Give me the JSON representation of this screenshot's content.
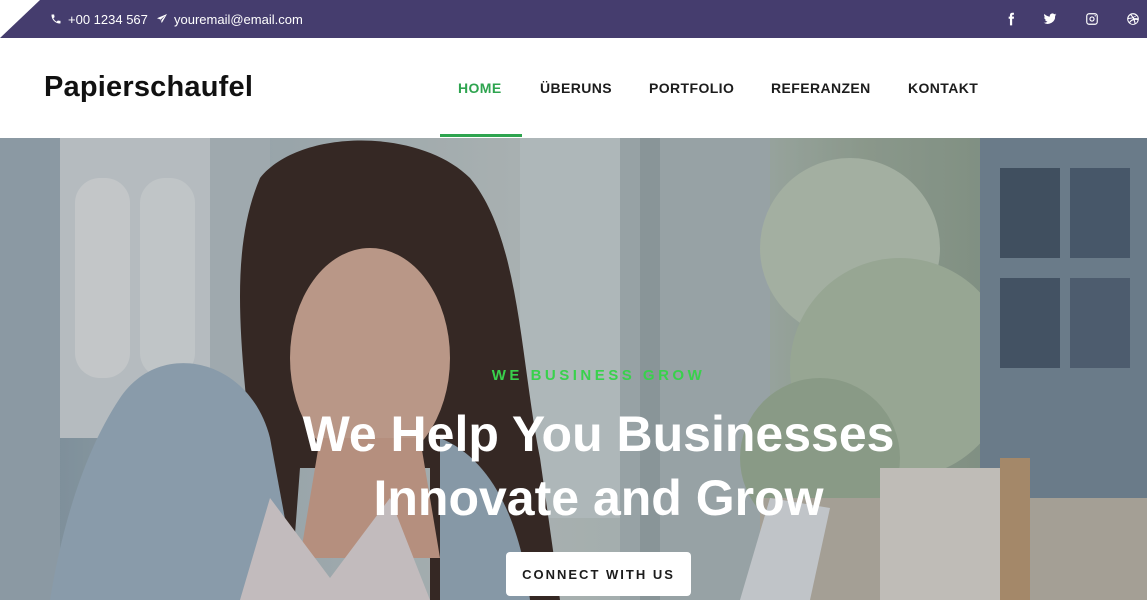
{
  "topbar": {
    "phone": "+00 1234 567",
    "email": "youremail@email.com",
    "icons": [
      "phone-icon",
      "paper-plane-icon"
    ],
    "social": [
      "facebook-icon",
      "twitter-icon",
      "instagram-icon",
      "dribbble-icon"
    ]
  },
  "colors": {
    "topbar": "#453d6e",
    "accent": "#2ea44f",
    "tagline": "#39d14c"
  },
  "brand": {
    "name": "Papierschaufel"
  },
  "nav": {
    "items": [
      {
        "label": "HOME",
        "active": true
      },
      {
        "label": "ÜBERUNS"
      },
      {
        "label": "PORTFOLIO"
      },
      {
        "label": "REFERANZEN"
      },
      {
        "label": "KONTAKT"
      }
    ]
  },
  "hero": {
    "tagline": "WE BUSINESS GROW",
    "headline_line1": "We Help You Businesses",
    "headline_line2": "Innovate and Grow",
    "cta": "CONNECT WITH US"
  }
}
